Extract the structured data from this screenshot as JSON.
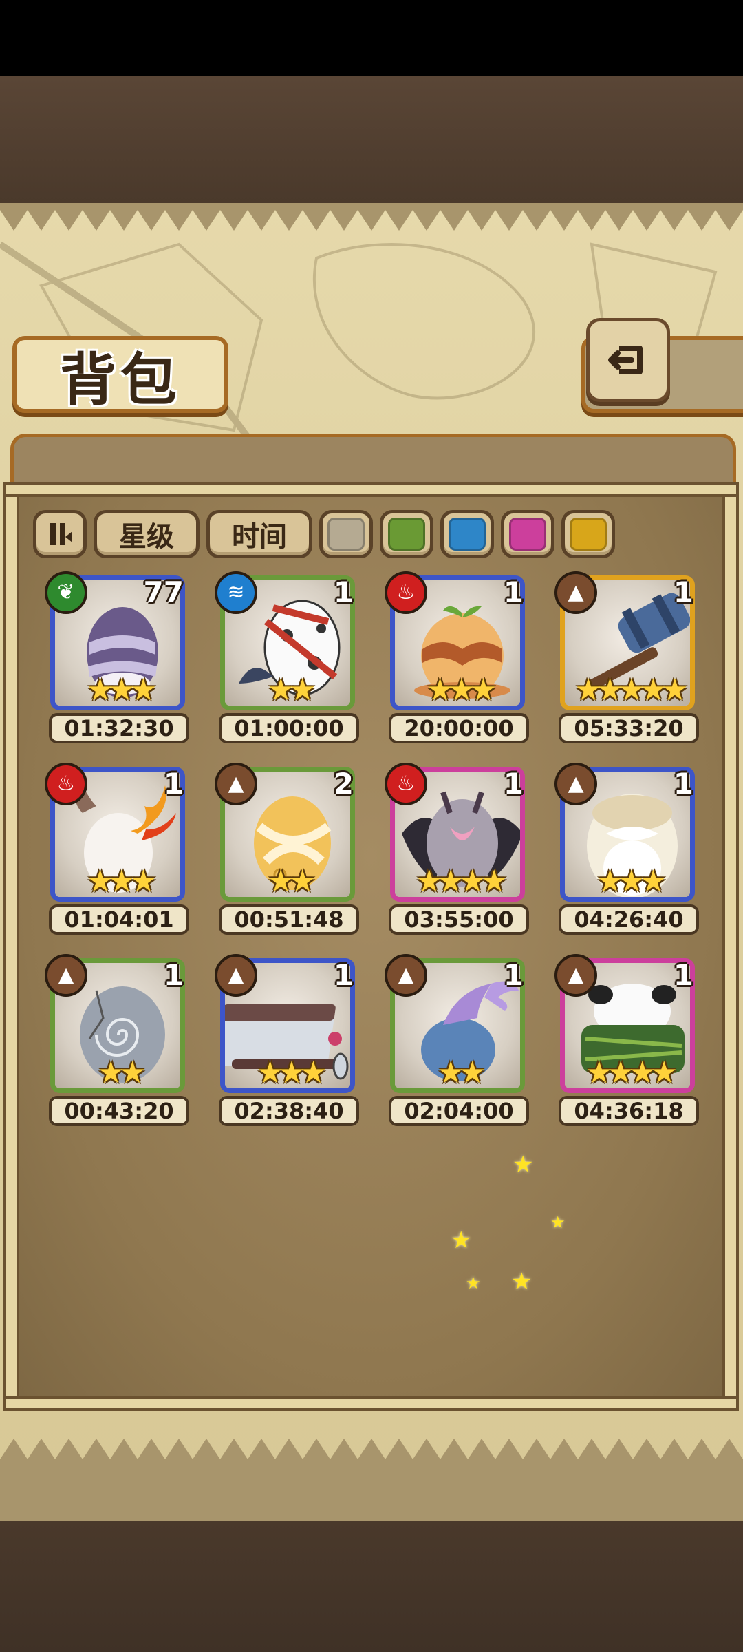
{
  "screen": {
    "title": "背包"
  },
  "buttons": {
    "back_icon": "back-arrow-icon",
    "sort_icon": "sort-toggle-icon",
    "filter_star": "星级",
    "filter_time": "时间"
  },
  "color_filters": [
    {
      "name": "gray",
      "color": "#b5aa92"
    },
    {
      "name": "green",
      "color": "#6a9a34"
    },
    {
      "name": "blue",
      "color": "#2e86c8"
    },
    {
      "name": "pink",
      "color": "#cc3f9c"
    },
    {
      "name": "yellow",
      "color": "#d8a61a"
    }
  ],
  "elements": {
    "grass": "#2e8a2e",
    "water": "#1f7fcf",
    "fire": "#d01f1f",
    "earth": "#7a4c2e"
  },
  "rarity_colors": {
    "green": "#6a9a3a",
    "blue": "#3d55c8",
    "pink": "#cc3f9c",
    "yellow": "#e0a21e"
  },
  "items": [
    {
      "element": "grass",
      "rarity": "blue",
      "count": "77",
      "stars": 3,
      "timer": "01:32:30",
      "art": "purple-striped-egg"
    },
    {
      "element": "water",
      "rarity": "green",
      "count": "1",
      "stars": 2,
      "timer": "01:00:00",
      "art": "spotted-egg-with-ribbon"
    },
    {
      "element": "fire",
      "rarity": "blue",
      "count": "1",
      "stars": 3,
      "timer": "20:00:00",
      "art": "caramel-sprout-egg"
    },
    {
      "element": "earth",
      "rarity": "yellow",
      "count": "1",
      "stars": 5,
      "timer": "05:33:20",
      "art": "spiked-hammer"
    },
    {
      "element": "fire",
      "rarity": "blue",
      "count": "1",
      "stars": 3,
      "timer": "01:04:01",
      "art": "flaming-horned-egg"
    },
    {
      "element": "earth",
      "rarity": "green",
      "count": "2",
      "stars": 2,
      "timer": "00:51:48",
      "art": "bandaged-golden-egg"
    },
    {
      "element": "fire",
      "rarity": "pink",
      "count": "1",
      "stars": 4,
      "timer": "03:55:00",
      "art": "bat-winged-egg"
    },
    {
      "element": "earth",
      "rarity": "blue",
      "count": "1",
      "stars": 3,
      "timer": "04:26:40",
      "art": "bearded-egg"
    },
    {
      "element": "earth",
      "rarity": "green",
      "count": "1",
      "stars": 2,
      "timer": "00:43:20",
      "art": "spiral-stone-egg"
    },
    {
      "element": "earth",
      "rarity": "blue",
      "count": "1",
      "stars": 3,
      "timer": "02:38:40",
      "art": "book-with-earring"
    },
    {
      "element": "earth",
      "rarity": "green",
      "count": "1",
      "stars": 2,
      "timer": "02:04:00",
      "art": "mermaid-tail-egg"
    },
    {
      "element": "earth",
      "rarity": "pink",
      "count": "1",
      "stars": 4,
      "timer": "04:36:18",
      "art": "panda-bush-egg"
    }
  ]
}
